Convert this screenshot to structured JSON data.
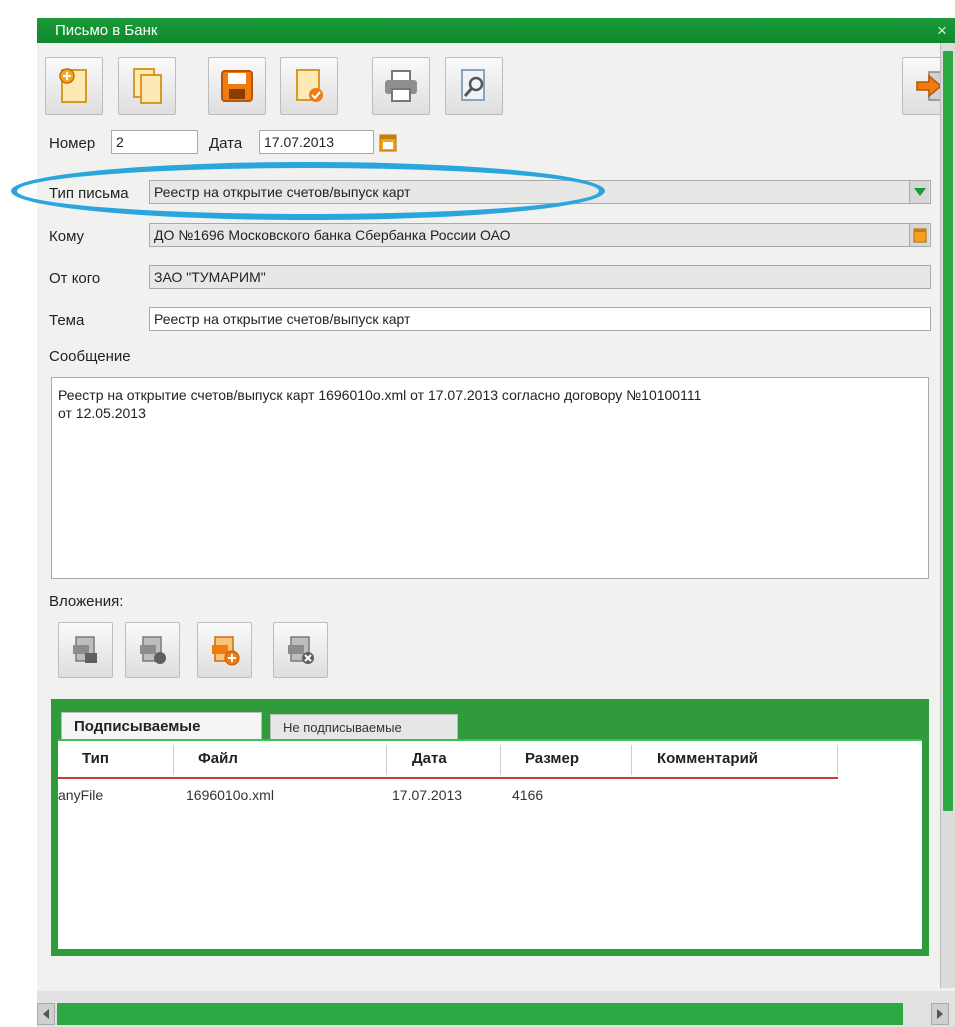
{
  "window": {
    "title": "Письмо в Банк",
    "close_glyph": "×"
  },
  "toolbar": {
    "icons": [
      "new-doc-icon",
      "copy-doc-icon",
      "save-icon",
      "sign-icon",
      "print-icon",
      "preview-icon",
      "exit-icon"
    ]
  },
  "form": {
    "number_label": "Номер",
    "number_value": "2",
    "date_label": "Дата",
    "date_value": "17.07.2013",
    "letter_type_label": "Тип письма",
    "letter_type_value": "Реестр на открытие счетов/выпуск карт",
    "to_label": "Кому",
    "to_value": "ДО №1696 Московского банка Сбербанка России ОАО",
    "from_label": "От кого",
    "from_value": "ЗАО \"ТУМАРИМ\"",
    "subject_label": "Тема",
    "subject_value": "Реестр на открытие счетов/выпуск карт",
    "message_label": "Сообщение",
    "message_value": "Реестр на открытие счетов/выпуск карт 1696010о.xml от 17.07.2013 согласно договору №10100111\nот 12.05.2013"
  },
  "attachments": {
    "label": "Вложения:",
    "icons": [
      "attach-file-icon",
      "attach-info-icon",
      "attach-add-icon",
      "attach-delete-icon"
    ],
    "tabs": {
      "signed": "Подписываемые",
      "unsigned": "Не подписываемые"
    },
    "columns": [
      "Тип",
      "Файл",
      "Дата",
      "Размер",
      "Комментарий"
    ],
    "rows": [
      {
        "type": "anyFile",
        "file": "1696010o.xml",
        "date": "17.07.2013",
        "size": "4166",
        "comment": ""
      }
    ]
  },
  "colors": {
    "accent": "#1b9a39",
    "highlight": "#2aa6dd",
    "header_underline": "#c93a3a"
  }
}
